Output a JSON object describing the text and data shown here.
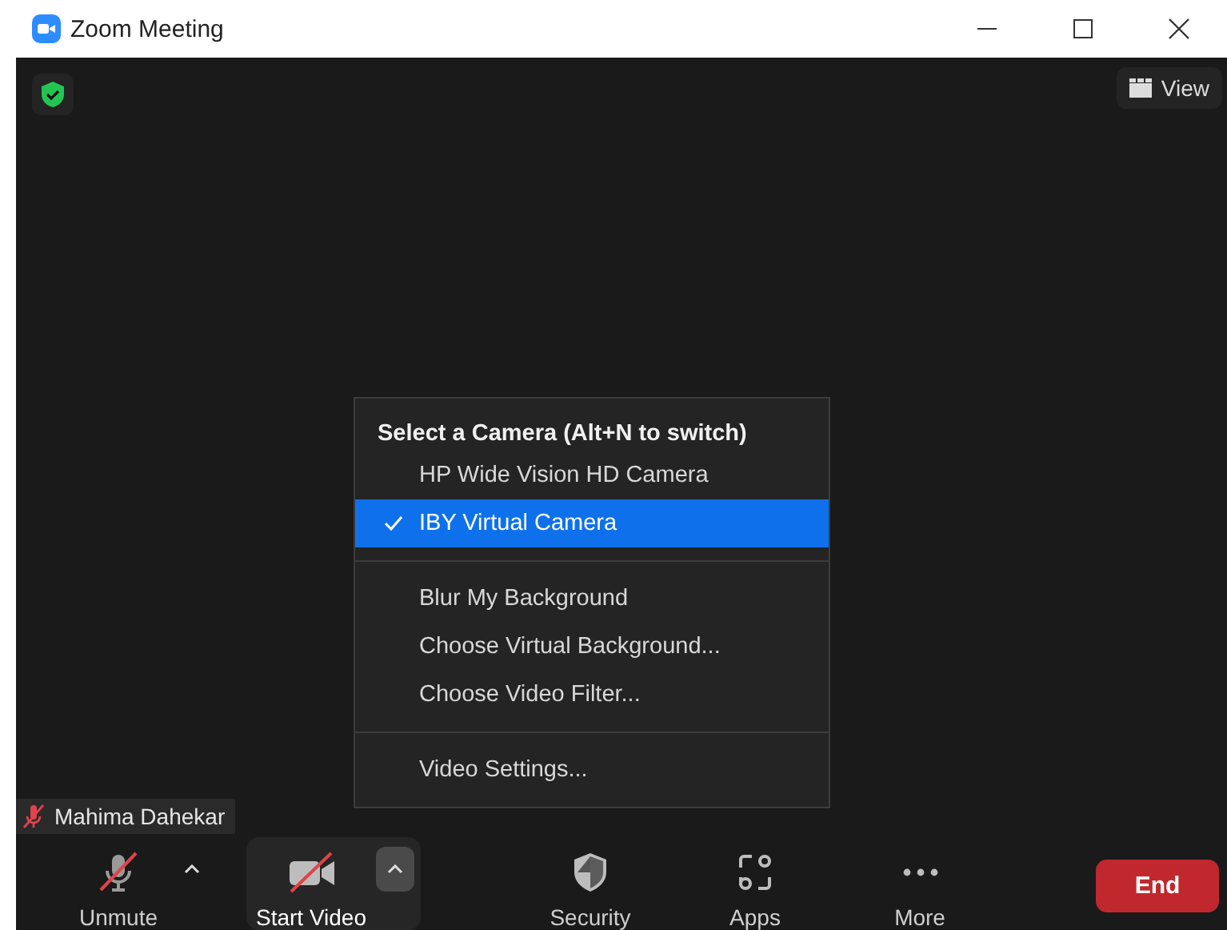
{
  "window": {
    "title": "Zoom Meeting"
  },
  "view_button": {
    "label": "View"
  },
  "name_tag": {
    "name": "Mahima Dahekar",
    "muted": true
  },
  "camera_menu": {
    "heading": "Select a Camera (Alt+N to switch)",
    "sections": [
      [
        {
          "label": "HP Wide Vision HD Camera",
          "selected": false
        },
        {
          "label": "IBY Virtual Camera",
          "selected": true
        }
      ],
      [
        {
          "label": "Blur My Background",
          "selected": false
        },
        {
          "label": "Choose Virtual Background...",
          "selected": false
        },
        {
          "label": "Choose Video Filter...",
          "selected": false
        }
      ],
      [
        {
          "label": "Video Settings...",
          "selected": false
        }
      ]
    ]
  },
  "toolbar": [
    {
      "kind": "mic",
      "label": "Unmute",
      "caret": true,
      "active": false
    },
    {
      "kind": "video",
      "label": "Start Video",
      "caret": true,
      "active": true
    },
    {
      "kind": "security",
      "label": "Security",
      "caret": false,
      "active": false
    },
    {
      "kind": "apps",
      "label": "Apps",
      "caret": false,
      "active": false
    },
    {
      "kind": "more",
      "label": "More",
      "caret": false,
      "active": false
    }
  ],
  "end_button": {
    "label": "End"
  }
}
